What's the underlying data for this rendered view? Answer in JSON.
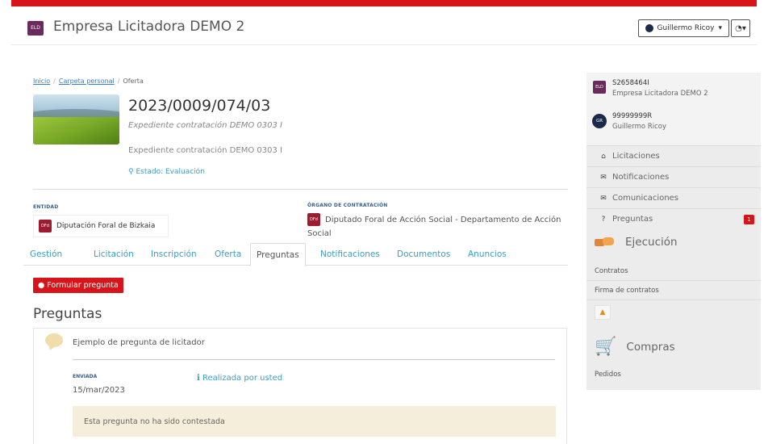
{
  "navbar": {
    "logo_text": "ELD",
    "brand": "Empresa Licitadora DEMO 2",
    "user_label": "Guillermo Ricoy",
    "user_caret": "▾",
    "settings_label": "◔▾"
  },
  "breadcrumb": {
    "items": [
      "Inicio",
      "Carpeta personal"
    ],
    "current": "Oferta",
    "separator": "/"
  },
  "expediente": {
    "title": "2023/0009/074/03",
    "subtitle": "Expediente contratación DEMO 0303 I",
    "description": "Expediente contratación DEMO 0303 I",
    "estado": "Estado: Evaluación"
  },
  "entidad": {
    "label": "ENTIDAD",
    "logo_text": "DFd",
    "name": "Diputación Foral de Bizkaia"
  },
  "organo": {
    "label": "ÓRGANO DE CONTRATACIÓN",
    "logo_text": "DFd",
    "name": "Diputado Foral de Acción Social - Departamento de Acción Social"
  },
  "tabs": [
    "Gestión",
    "Licitación",
    "Inscripción",
    "Oferta",
    "Preguntas",
    "Notificaciones",
    "Documentos",
    "Anuncios"
  ],
  "active_tab": "Preguntas",
  "actions": {
    "formular": "Formular pregunta"
  },
  "section_title": "Preguntas",
  "question": {
    "text": "Ejemplo de pregunta de licitador",
    "status_label": "ENVIADA",
    "date": "15/mar/2023",
    "by_icon": "i",
    "by": "Realizada por usted",
    "alert": "Esta pregunta no ha sido contestada"
  },
  "sidebar": {
    "company": {
      "badge": "ELD",
      "id": "S2658464I",
      "name": "Empresa Licitadora DEMO 2"
    },
    "user": {
      "badge": "GR",
      "id": "99999999R",
      "name": "Guillermo Ricoy"
    },
    "menu": [
      {
        "label": "Licitaciones",
        "icon": "inbox-icon"
      },
      {
        "label": "Notificaciones",
        "icon": "envelope-icon"
      },
      {
        "label": "Comunicaciones",
        "icon": "envelope-icon"
      },
      {
        "label": "Preguntas",
        "icon": "question-circle-icon",
        "badge": "1"
      }
    ],
    "ejecucion": {
      "title": "Ejecución",
      "items": [
        "Contratos",
        "Firma de contratos"
      ]
    },
    "compras": {
      "title": "Compras",
      "items": [
        "Pedidos"
      ]
    }
  },
  "colors": {
    "accent_red": "#d7141a",
    "link_blue": "#3a9fc1",
    "brand_purple": "#6b2a5c",
    "alert_bg": "#f5eedb"
  }
}
